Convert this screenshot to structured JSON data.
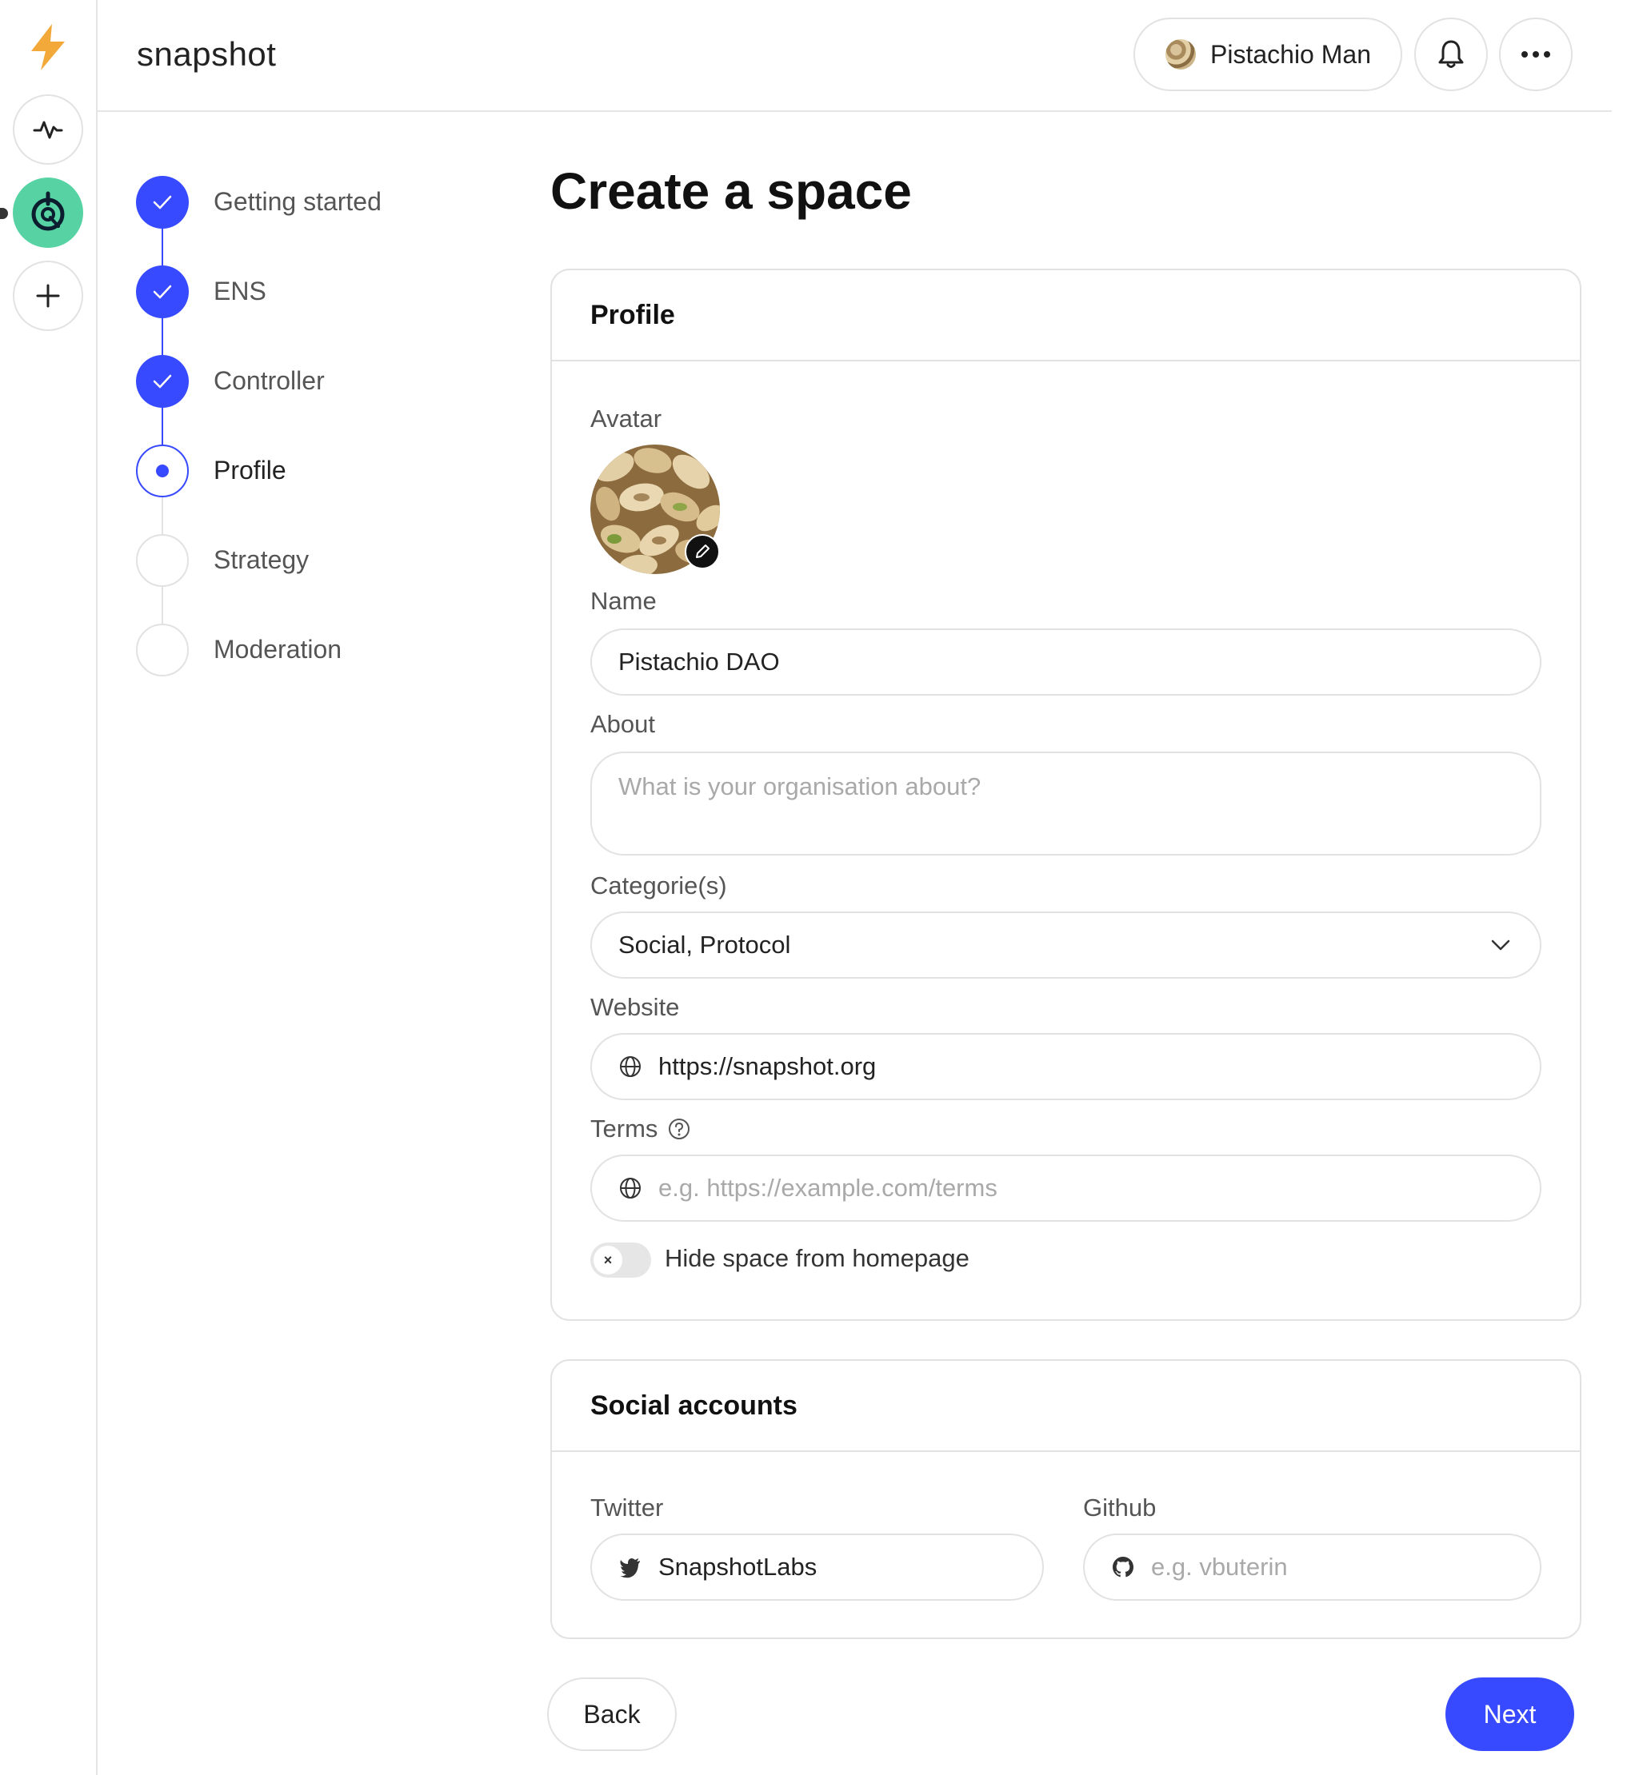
{
  "app": {
    "brand": "snapshot",
    "user_name": "Pistachio Man"
  },
  "icons": {
    "logo": "lightning-bolt-icon",
    "activity": "activity-icon",
    "add_space": "plus-icon",
    "notifications": "bell-icon",
    "more": "more-horizontal-icon",
    "check": "check-icon",
    "edit": "pencil-icon",
    "globe": "globe-icon",
    "help": "question-circle-icon",
    "chevron": "chevron-down-icon",
    "twitter": "twitter-icon",
    "github": "github-icon"
  },
  "colors": {
    "accent": "#384aff",
    "space_avatar": "#57d3a3",
    "logo": "#f3a83a"
  },
  "steps": [
    {
      "label": "Getting started",
      "state": "done"
    },
    {
      "label": "ENS",
      "state": "done"
    },
    {
      "label": "Controller",
      "state": "done"
    },
    {
      "label": "Profile",
      "state": "current"
    },
    {
      "label": "Strategy",
      "state": "todo"
    },
    {
      "label": "Moderation",
      "state": "todo"
    }
  ],
  "main": {
    "title": "Create a space"
  },
  "profile": {
    "heading": "Profile",
    "avatar_label": "Avatar",
    "name_label": "Name",
    "name_value": "Pistachio DAO",
    "about_label": "About",
    "about_placeholder": "What is your organisation about?",
    "categories_label": "Categorie(s)",
    "categories_value": "Social, Protocol",
    "website_label": "Website",
    "website_value": "https://snapshot.org",
    "terms_label": "Terms",
    "terms_placeholder": "e.g. https://example.com/terms",
    "hide_label": "Hide space from homepage",
    "hide_toggle_glyph": "×",
    "hide_enabled": false
  },
  "social": {
    "heading": "Social accounts",
    "twitter_label": "Twitter",
    "twitter_value": "SnapshotLabs",
    "github_label": "Github",
    "github_placeholder": "e.g. vbuterin"
  },
  "actions": {
    "back": "Back",
    "next": "Next"
  }
}
